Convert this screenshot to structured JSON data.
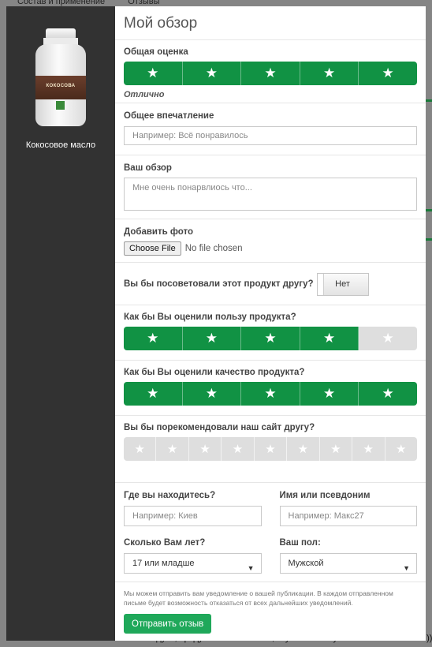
{
  "background": {
    "tabs": [
      "Состав и применение",
      "Отзывы"
    ],
    "bottom_text": "после солнечных ожогов. Рекомендую , продукт качественный , вкусный к тому же ОЧЕНЬ полезный )))"
  },
  "product": {
    "name": "Кокосовое масло",
    "jar_label": "КОКОСОВА"
  },
  "form": {
    "title": "Мой обзор",
    "overall_rating": {
      "label": "Общая оценка",
      "value": 5,
      "max": 5,
      "text": "Отлично"
    },
    "impression": {
      "label": "Общее впечатление",
      "placeholder": "Например: Всё понравилось"
    },
    "review": {
      "label": "Ваш обзор",
      "placeholder": "Мне очень понарвлиось что..."
    },
    "photo": {
      "label": "Добавить фото",
      "button": "Choose File",
      "status": "No file chosen"
    },
    "recommend_friend": {
      "label": "Вы бы посоветовали этот продукт другу?",
      "value": "Нет"
    },
    "benefit_rating": {
      "label": "Как бы Вы оценили пользу продукта?",
      "value": 4,
      "max": 5
    },
    "quality_rating": {
      "label": "Как бы Вы оценили качество продукта?",
      "value": 5,
      "max": 5
    },
    "site_rating": {
      "label": "Вы бы порекомендовали наш сайт другу?",
      "value": 0,
      "max": 9
    },
    "location": {
      "label": "Где вы находитесь?",
      "placeholder": "Например: Киев"
    },
    "nickname": {
      "label": "Имя или псевдоним",
      "placeholder": "Например: Макс27"
    },
    "age": {
      "label": "Сколько Вам лет?",
      "value": "17 или младше"
    },
    "gender": {
      "label": "Ваш пол:",
      "value": "Мужской"
    },
    "notice": "Мы можем отправить вам уведомление о вашей публикации. В каждом отправленном письме будет возможность отказаться от всех дальнейших уведомлений.",
    "submit": "Отправить отзыв"
  },
  "colors": {
    "accent": "#119244",
    "submit": "#1fa85a",
    "sidebar": "#323232"
  }
}
